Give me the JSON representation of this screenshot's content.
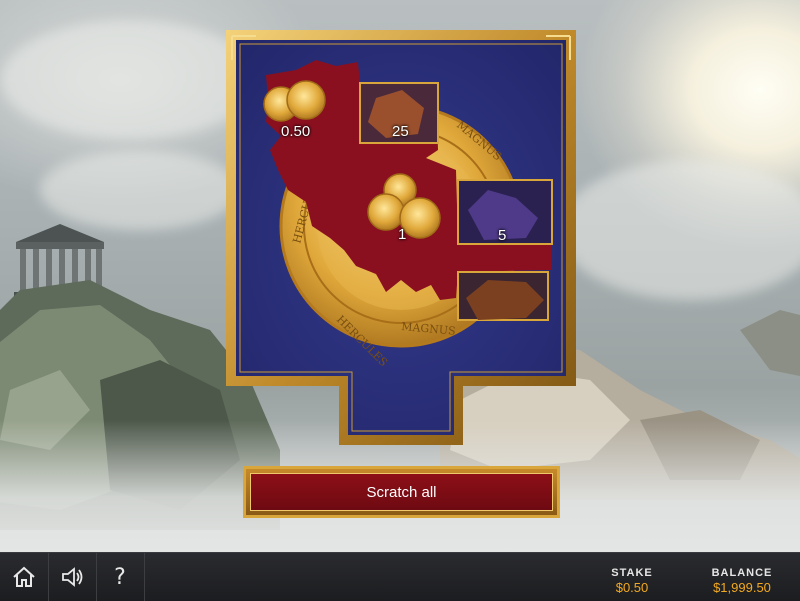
{
  "game": {
    "prizes": {
      "top_left": "0.50",
      "top_right": "25",
      "middle": "1",
      "right": "5"
    },
    "medallion_text": [
      "HERCULES",
      "MAGNUS",
      "HERCULES",
      "MAGNUS"
    ]
  },
  "scratch_button": {
    "label": "Scratch all"
  },
  "bottom_bar": {
    "home_icon": "home-icon",
    "sound_icon": "speaker-icon",
    "help_label": "?",
    "stake": {
      "label": "STAKE",
      "value": "$0.50"
    },
    "balance": {
      "label": "BALANCE",
      "value": "$1,999.50"
    }
  },
  "colors": {
    "accent_gold": "#d9a63c",
    "button_red": "#8d0f17",
    "card_blue": "#2b2f78",
    "value_orange": "#f3a91f"
  }
}
